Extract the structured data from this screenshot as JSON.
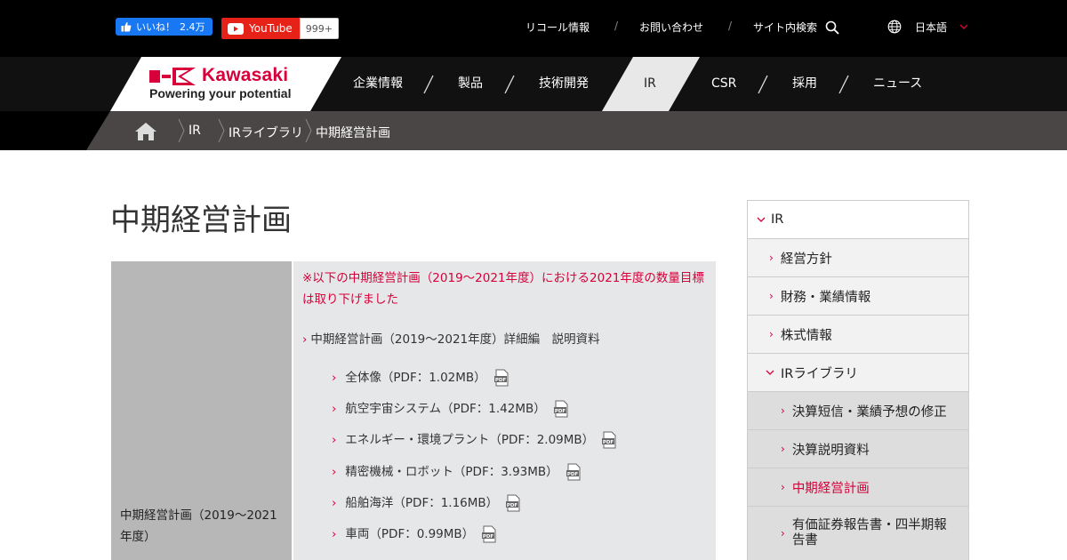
{
  "social": {
    "fb_like_label": "いいね！",
    "fb_like_count": "2.4万",
    "youtube_label": "YouTube",
    "youtube_count": "999+"
  },
  "utility_nav": {
    "recall": "リコール情報",
    "contact": "お問い合わせ",
    "site_search": "サイト内検索",
    "separator": "/",
    "language": "日本語"
  },
  "brand": {
    "name": "Kawasaki",
    "tagline": "Powering your potential",
    "color": "#d7003a"
  },
  "main_nav": {
    "items": [
      "企業情報",
      "製品",
      "技術開発",
      "IR",
      "CSR",
      "採用",
      "ニュース"
    ],
    "active": "IR"
  },
  "breadcrumb": [
    "IR",
    "IRライブラリ",
    "中期経営計画"
  ],
  "page": {
    "title": "中期経営計画",
    "row_label": "中期経営計画（2019～2021年度）",
    "notice": "※以下の中期経営計画（2019～2021年度）における2021年度の数量目標は取り下げました",
    "subheading": "中期経営計画（2019～2021年度）詳細編　説明資料",
    "downloads": [
      "全体像（PDF：1.02MB）",
      "航空宇宙システム（PDF：1.42MB）",
      "エネルギー・環境プラント（PDF：2.09MB）",
      "精密機械・ロボット（PDF：3.93MB）",
      "船舶海洋（PDF：1.16MB）",
      "車両（PDF：0.99MB）"
    ]
  },
  "side_nav": {
    "root": "IR",
    "items": [
      "経営方針",
      "財務・業績情報",
      "株式情報",
      "IRライブラリ"
    ],
    "sub_items": [
      "決算短信・業績予想の修正",
      "決算説明資料",
      "中期経営計画",
      "有価証券報告書・四半期報告書"
    ],
    "current": "中期経営計画"
  },
  "icons": [
    "thumbs-up-icon",
    "play-icon",
    "search-icon",
    "globe-icon",
    "chevron-down-icon",
    "home-icon",
    "pdf-icon",
    "chevron-right-icon"
  ]
}
